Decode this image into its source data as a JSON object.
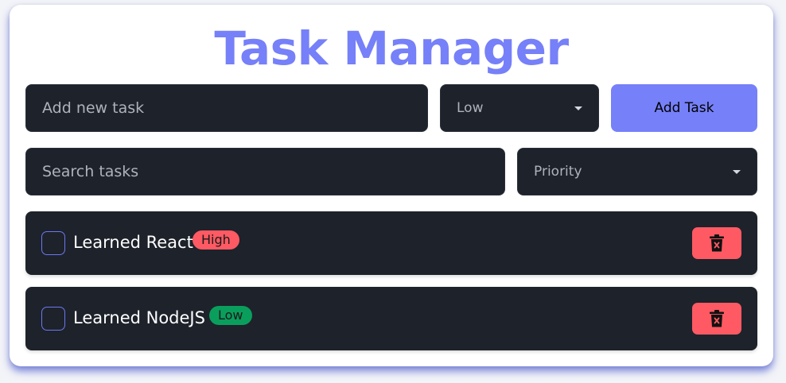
{
  "colors": {
    "accent": "#7680f8",
    "dark": "#1e222b",
    "danger": "#ff5a63",
    "high_badge": "#ff5a63",
    "low_badge": "#0a9e5c"
  },
  "header": {
    "title": "Task Manager"
  },
  "new_task": {
    "placeholder": "Add new task",
    "priority_selected": "Low",
    "add_label": "Add Task"
  },
  "filters": {
    "search_placeholder": "Search tasks",
    "priority_filter_selected": "Priority"
  },
  "tasks": [
    {
      "label": "Learned React",
      "priority": "High",
      "checked": false,
      "delete_icon": "trash-icon"
    },
    {
      "label": "Learned NodeJS",
      "priority": "Low",
      "checked": false,
      "delete_icon": "trash-icon"
    }
  ]
}
